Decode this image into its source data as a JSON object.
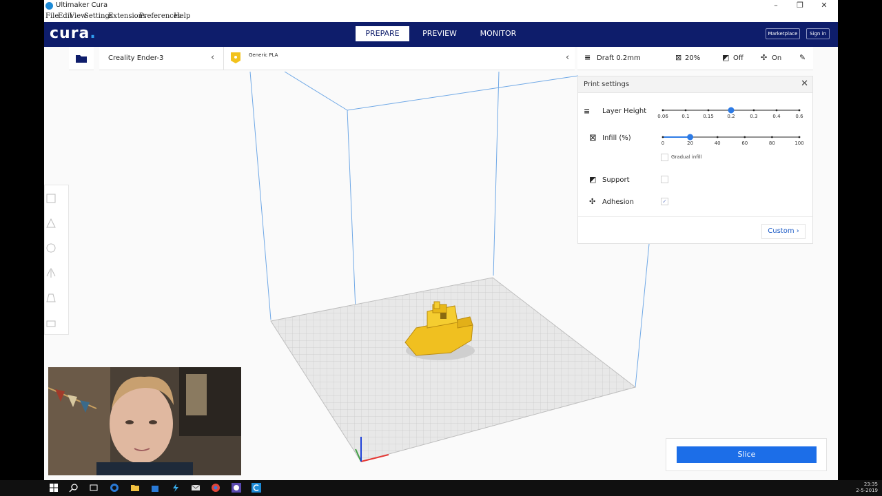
{
  "window": {
    "title": "Ultimaker Cura"
  },
  "menu": [
    "File",
    "Edit",
    "View",
    "Settings",
    "Extensions",
    "Preferences",
    "Help"
  ],
  "header": {
    "brand": "cura",
    "brand_dot": ".",
    "tabs": [
      "PREPARE",
      "PREVIEW",
      "MONITOR"
    ],
    "active_tab": "PREPARE",
    "marketplace": "Marketplace",
    "signin": "Sign in"
  },
  "toolbar": {
    "machine": "Creality Ender-3",
    "material": "Generic PLA",
    "profile": "Draft 0.2mm",
    "infill": "20%",
    "support": "Off",
    "adhesion": "On"
  },
  "print_settings": {
    "title": "Print settings",
    "layer_height": {
      "label": "Layer Height",
      "ticks": [
        "0.06",
        "0.1",
        "0.15",
        "0.2",
        "0.3",
        "0.4",
        "0.6"
      ],
      "selected_index": 3
    },
    "infill": {
      "label": "Infill (%)",
      "ticks": [
        "0",
        "20",
        "40",
        "60",
        "80",
        "100"
      ],
      "value": 20,
      "gradual_label": "Gradual infill",
      "gradual_checked": false
    },
    "support": {
      "label": "Support",
      "checked": false
    },
    "adhesion": {
      "label": "Adhesion",
      "checked": true,
      "check_glyph": "✓"
    },
    "custom_label": "Custom"
  },
  "slice": {
    "label": "Slice"
  },
  "clock": {
    "time": "23:35",
    "date": "2-5-2019"
  },
  "colors": {
    "header": "#0e1d6b",
    "accent": "#1c6ee8",
    "model": "#f2c21c"
  }
}
